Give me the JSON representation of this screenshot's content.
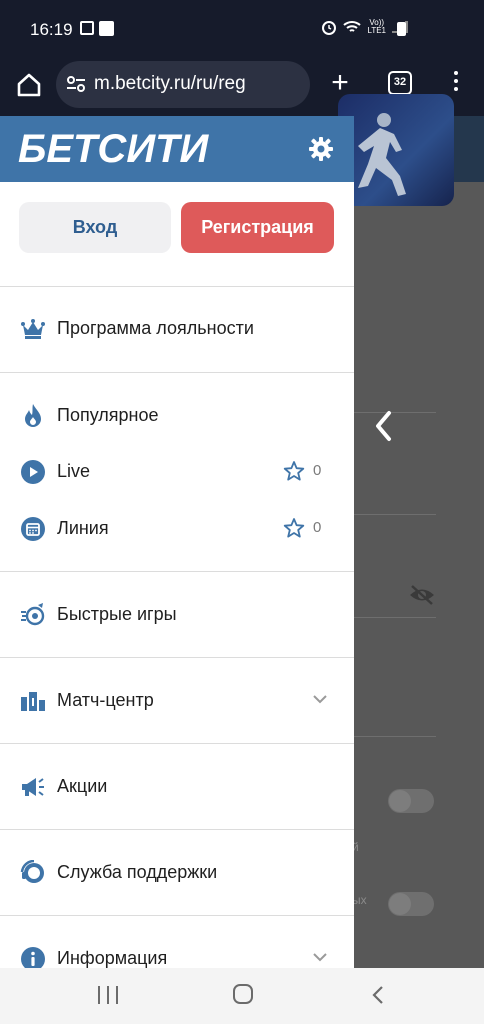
{
  "status_bar": {
    "time": "16:19",
    "right_label": "Vo))\nLTE1",
    "icons": [
      "gallery-icon",
      "puzzle-icon",
      "alarm-icon",
      "wifi-icon",
      "volte-icon",
      "signal-icon",
      "battery-icon"
    ]
  },
  "browser": {
    "url": "m.betcity.ru/ru/reg",
    "tab_count": "32",
    "plus_label": "+"
  },
  "drawer": {
    "brand": "БЕТСИТИ",
    "login_label": "Вход",
    "register_label": "Регистрация",
    "items": [
      {
        "label": "Программа лояльности",
        "icon": "crown-icon"
      },
      {
        "label": "Популярное",
        "icon": "flame-icon"
      },
      {
        "label": "Live",
        "icon": "play-icon",
        "favorites": "0"
      },
      {
        "label": "Линия",
        "icon": "calendar-icon",
        "favorites": "0"
      },
      {
        "label": "Быстрые игры",
        "icon": "fast-games-icon"
      },
      {
        "label": "Матч-центр",
        "icon": "stats-icon"
      },
      {
        "label": "Акции",
        "icon": "megaphone-icon"
      },
      {
        "label": "Служба поддержки",
        "icon": "support-icon"
      },
      {
        "label": "Информация",
        "icon": "info-icon"
      }
    ]
  },
  "background_fragments": {
    "frag_1": "й",
    "frag_2": "ых"
  },
  "colors": {
    "brand_blue": "#3f74a8",
    "register_red": "#de5a5a",
    "login_text": "#2f5e90",
    "system_bar": "#161b2b"
  }
}
